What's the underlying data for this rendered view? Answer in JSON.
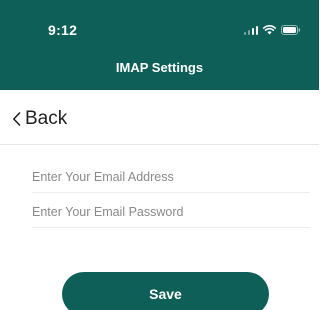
{
  "status_bar": {
    "time": "9:12",
    "icons": [
      "signal-icon",
      "wifi-icon",
      "battery-icon"
    ]
  },
  "header": {
    "title": "IMAP Settings"
  },
  "nav": {
    "back_label": "Back"
  },
  "form": {
    "email": {
      "placeholder": "Enter Your Email Address",
      "value": ""
    },
    "password": {
      "placeholder": "Enter Your Email Password",
      "value": ""
    }
  },
  "actions": {
    "save_label": "Save"
  },
  "colors": {
    "brand": "#0f5f59",
    "background": "#ffffff",
    "text": "#222222",
    "placeholder": "#8a8a8a"
  }
}
